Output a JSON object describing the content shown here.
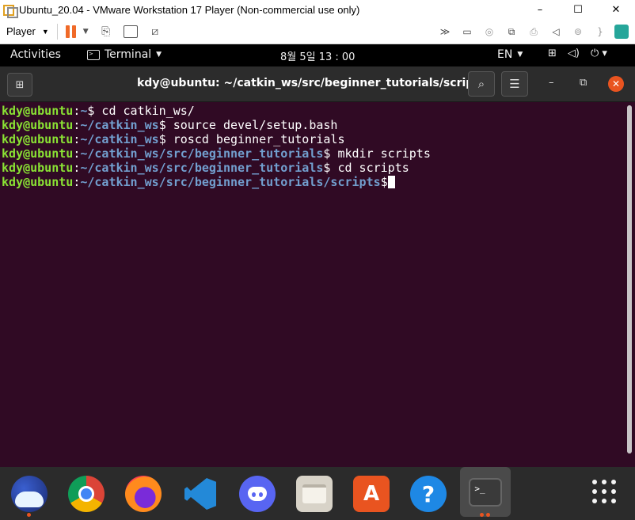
{
  "window": {
    "title": "Ubuntu_20.04 - VMware Workstation 17 Player (Non-commercial use only)",
    "minimize": "–",
    "maximize": "☐",
    "close": "✕"
  },
  "vm_toolbar": {
    "player_label": "Player",
    "icons": [
      "pause-icon",
      "send-ctrl-alt-del-icon",
      "fullscreen-icon",
      "unity-icon",
      "forward-icon",
      "hdd-icon",
      "cd-icon",
      "network-icon",
      "printer-icon",
      "sound-icon",
      "usb-icon",
      "bluetooth-icon",
      "message-icon"
    ]
  },
  "gnome": {
    "activities": "Activities",
    "app_menu": "Terminal",
    "clock": "8월 5일  13 : 00",
    "lang": "EN"
  },
  "terminal": {
    "title": "kdy@ubuntu: ~/catkin_ws/src/beginner_tutorials/scripts",
    "lines": [
      {
        "user": "kdy@ubuntu",
        "path": "~",
        "cmd": "$ cd catkin_ws/"
      },
      {
        "user": "kdy@ubuntu",
        "path": "~/catkin_ws",
        "cmd": "$ source devel/setup.bash"
      },
      {
        "user": "kdy@ubuntu",
        "path": "~/catkin_ws",
        "cmd": "$ roscd beginner_tutorials"
      },
      {
        "user": "kdy@ubuntu",
        "path": "~/catkin_ws/src/beginner_tutorials",
        "cmd": "$ mkdir scripts"
      },
      {
        "user": "kdy@ubuntu",
        "path": "~/catkin_ws/src/beginner_tutorials",
        "cmd": "$ cd scripts"
      },
      {
        "user": "kdy@ubuntu",
        "path": "~/catkin_ws/src/beginner_tutorials/scripts",
        "cmd": "$"
      }
    ],
    "colors": {
      "background": "#300a24",
      "user": "#8ae234",
      "path": "#729fcf"
    }
  },
  "dock": {
    "apps": [
      "whale-browser",
      "chrome",
      "firefox",
      "vscode",
      "discord",
      "files",
      "software-store",
      "help",
      "terminal"
    ],
    "help_glyph": "?",
    "terminal_glyph": ">_"
  }
}
